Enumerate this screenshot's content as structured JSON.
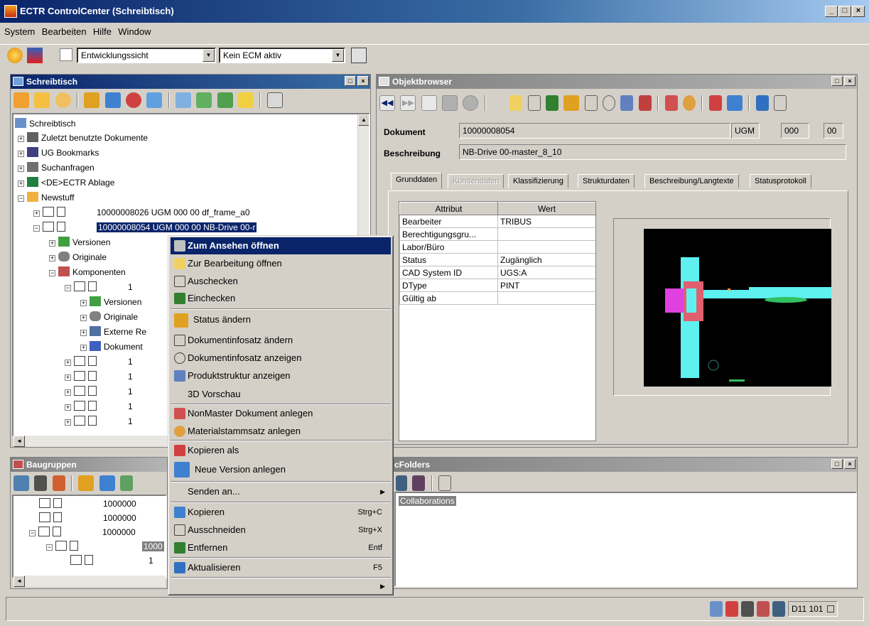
{
  "window": {
    "title": "ECTR ControlCenter (Schreibtisch)",
    "min": "_",
    "max": "□",
    "close": "×"
  },
  "menu": [
    "System",
    "Bearbeiten",
    "Hilfe",
    "Window"
  ],
  "toolbar": {
    "view_combo": "Entwicklungssicht",
    "ecm_combo": "Kein ECM aktiv"
  },
  "desk": {
    "title": "Schreibtisch",
    "tree": [
      {
        "label": "Schreibtisch"
      },
      {
        "label": "Zuletzt benutzte Dokumente"
      },
      {
        "label": "UG Bookmarks"
      },
      {
        "label": "Suchanfragen"
      },
      {
        "label": "<DE>ECTR Ablage"
      },
      {
        "label": "Newstuff"
      },
      {
        "label": "10000008026  UGM  000    00    df_frame_a0"
      },
      {
        "label": "10000008054  UGM  000    00    NB-Drive 00-r"
      },
      {
        "label": "Versionen"
      },
      {
        "label": "Originale"
      },
      {
        "label": "Komponenten"
      },
      {
        "label": "1"
      },
      {
        "label": "Versionen"
      },
      {
        "label": "Originale"
      },
      {
        "label": "Externe Re"
      },
      {
        "label": "Dokument"
      },
      {
        "label": "1"
      },
      {
        "label": "1"
      },
      {
        "label": "1"
      },
      {
        "label": "1"
      },
      {
        "label": "1"
      }
    ]
  },
  "baugruppen": {
    "title": "Baugruppen",
    "rows": [
      {
        "label": "1000000"
      },
      {
        "label": "1000000"
      },
      {
        "label": "1000000"
      },
      {
        "label": "1000"
      },
      {
        "label": "1"
      }
    ]
  },
  "objectbrowser": {
    "title": "Objektbrowser",
    "dokument_label": "Dokument",
    "dokument_value": "10000008054",
    "type": "UGM",
    "ver": "000",
    "rev": "00",
    "beschreibung_label": "Beschreibung",
    "beschreibung_value": "NB-Drive 00-master_8_10",
    "tabs": [
      "Grunddaten",
      "Kundendaten",
      "Klassifizierung",
      "Strukturdaten",
      "Beschreibung/Langtexte",
      "Statusprotokoll"
    ],
    "table_headers": [
      "Attribut",
      "Wert"
    ],
    "attributes": [
      {
        "name": "Bearbeiter",
        "value": "TRIBUS"
      },
      {
        "name": "Berechtigungsgru...",
        "value": ""
      },
      {
        "name": "Labor/Büro",
        "value": ""
      },
      {
        "name": "Status",
        "value": "Zugänglich"
      },
      {
        "name": "CAD System ID",
        "value": "UGS:A"
      },
      {
        "name": "DType",
        "value": "PINT"
      },
      {
        "name": "Gültig ab",
        "value": ""
      }
    ]
  },
  "folders": {
    "title": "cFolders",
    "item": "Collaborations"
  },
  "context_menu": {
    "items": [
      {
        "label": "Zum Ansehen öffnen"
      },
      {
        "label": "Zur Bearbeitung öffnen"
      },
      {
        "label": "Auschecken"
      },
      {
        "label": "Einchecken"
      },
      {
        "label": "Status ändern"
      },
      {
        "label": "Dokumentinfosatz ändern"
      },
      {
        "label": "Dokumentinfosatz anzeigen"
      },
      {
        "label": "Produktstruktur anzeigen"
      },
      {
        "label": "3D Vorschau"
      },
      {
        "label": "NonMaster Dokument anlegen"
      },
      {
        "label": "Materialstammsatz anlegen"
      },
      {
        "label": "Kopieren als"
      },
      {
        "label": "Neue Version anlegen"
      },
      {
        "label": "Senden an..."
      },
      {
        "label": "Kopieren",
        "shortcut": "Strg+C"
      },
      {
        "label": "Ausschneiden",
        "shortcut": "Strg+X"
      },
      {
        "label": "Entfernen",
        "shortcut": "Entf"
      },
      {
        "label": "Aktualisieren",
        "shortcut": "F5"
      }
    ]
  },
  "status": {
    "system": "D11 101"
  }
}
